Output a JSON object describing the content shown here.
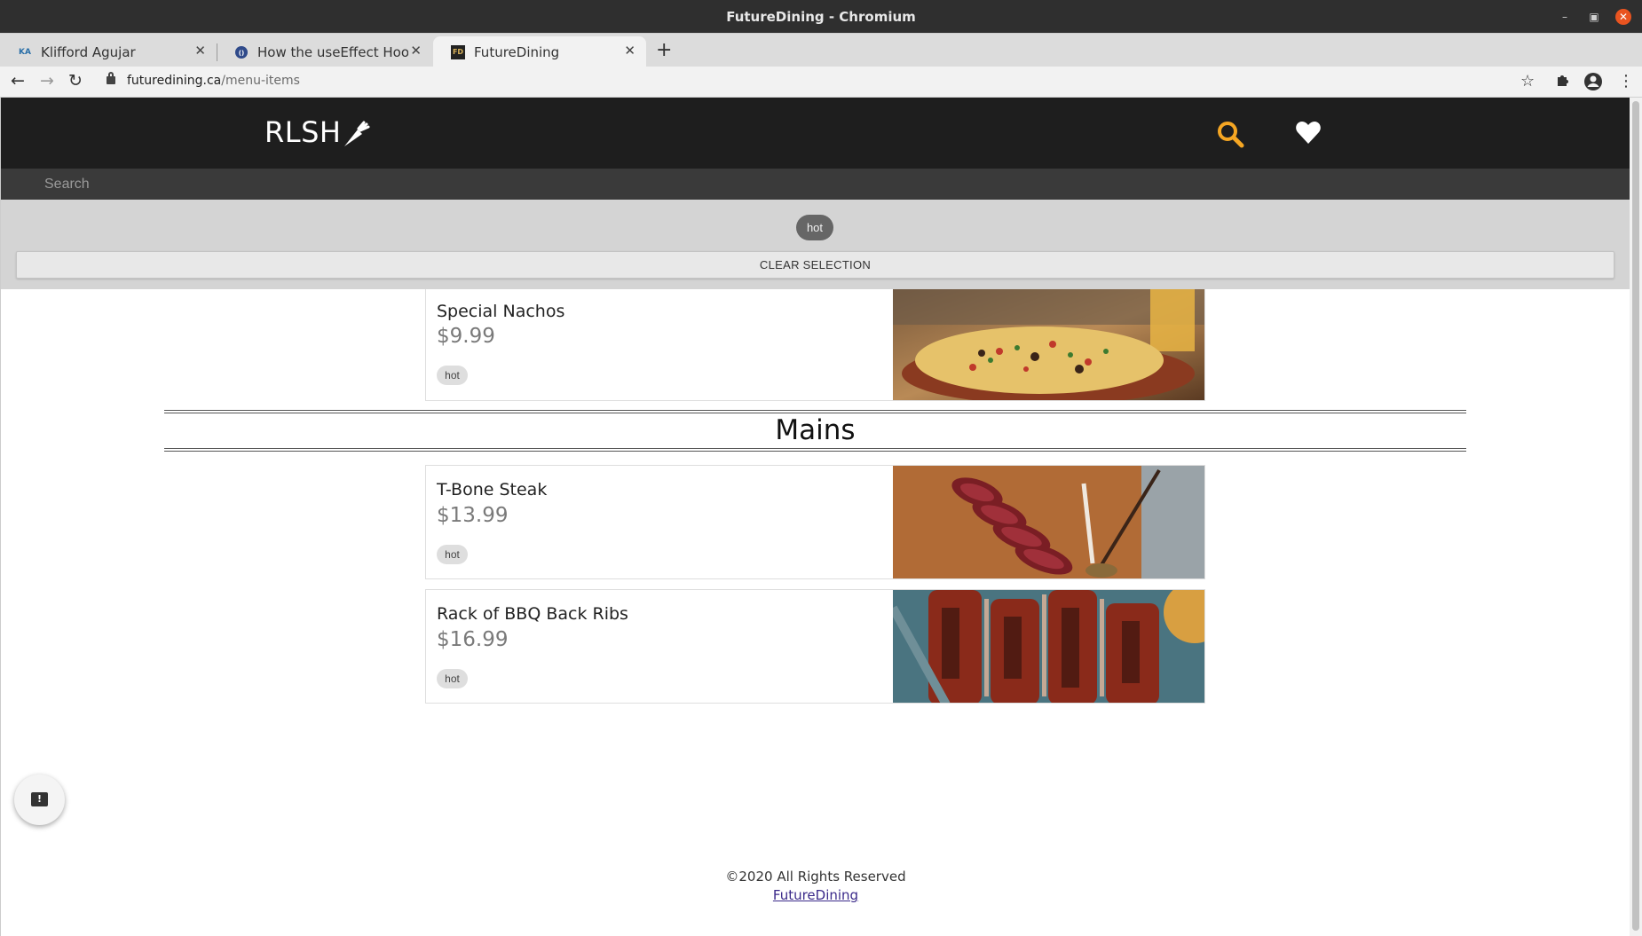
{
  "window": {
    "title": "FutureDining - Chromium"
  },
  "tabs": [
    {
      "label": "Klifford Agujar",
      "favicon": "KA"
    },
    {
      "label": "How the useEffect Hook W",
      "favicon": ""
    },
    {
      "label": "FutureDining",
      "favicon": "FD"
    }
  ],
  "address": {
    "host": "futuredining.ca",
    "path": "/menu-items"
  },
  "header": {
    "brand": "RLSH"
  },
  "search": {
    "placeholder": "Search",
    "value": ""
  },
  "filters": {
    "active_chip": "hot",
    "clear_label": "CLEAR SELECTION"
  },
  "menu": {
    "items_before": [
      {
        "name": "Special Nachos",
        "price": "$9.99",
        "tag": "hot"
      }
    ],
    "section": "Mains",
    "mains": [
      {
        "name": "T-Bone Steak",
        "price": "$13.99",
        "tag": "hot"
      },
      {
        "name": "Rack of BBQ Back Ribs",
        "price": "$16.99",
        "tag": "hot"
      }
    ]
  },
  "footer": {
    "copyright": "©2020 All Rights Reserved",
    "link": "FutureDining"
  },
  "colors": {
    "header_bg": "#1e1e1e",
    "accent": "#f5a623",
    "filter_bg": "#d4d4d4"
  }
}
